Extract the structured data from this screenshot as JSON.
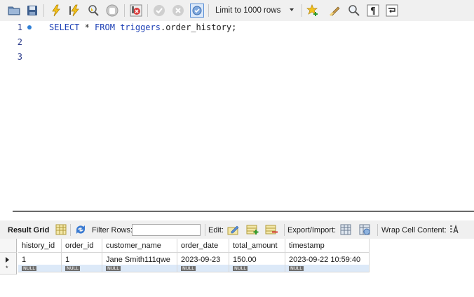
{
  "toolbar": {
    "buttons": [
      {
        "name": "open-folder-icon"
      },
      {
        "name": "save-icon"
      },
      {
        "name": "execute-lightning-icon"
      },
      {
        "name": "execute-cursor-lightning-icon"
      },
      {
        "name": "explain-magnifier-icon"
      },
      {
        "name": "stop-hand-icon"
      },
      {
        "name": "toggle-continue-on-error-icon"
      },
      {
        "name": "commit-check-icon"
      },
      {
        "name": "rollback-cancel-icon"
      },
      {
        "name": "autocommit-toggle-icon"
      },
      {
        "name": "add-snippet-star-icon"
      },
      {
        "name": "beautify-broom-icon"
      },
      {
        "name": "find-replace-magnifier-icon"
      },
      {
        "name": "invisible-chars-pilcrow-icon"
      },
      {
        "name": "wrap-lines-icon"
      }
    ],
    "limit_select": {
      "value": "Limit to 1000 rows"
    }
  },
  "editor": {
    "lines": [
      {
        "number": "1",
        "has_marker": true,
        "tokens": [
          {
            "text": "SELECT",
            "type": "kw"
          },
          {
            "text": " * ",
            "type": "plain"
          },
          {
            "text": "FROM",
            "type": "kw"
          },
          {
            "text": " ",
            "type": "plain"
          },
          {
            "text": "triggers",
            "type": "id"
          },
          {
            "text": ".order_history;",
            "type": "plain"
          }
        ]
      },
      {
        "number": "2",
        "has_marker": false,
        "tokens": []
      },
      {
        "number": "3",
        "has_marker": false,
        "tokens": []
      }
    ]
  },
  "result_toolbar": {
    "result_grid_label": "Result Grid",
    "filter_rows_label": "Filter Rows:",
    "filter_rows_value": "",
    "edit_label": "Edit:",
    "export_import_label": "Export/Import:",
    "wrap_cell_label": "Wrap Cell Content:"
  },
  "grid": {
    "columns": [
      "history_id",
      "order_id",
      "customer_name",
      "order_date",
      "total_amount",
      "timestamp"
    ],
    "rows": [
      [
        "1",
        "1",
        "Jane Smith111qwe",
        "2023-09-23",
        "150.00",
        "2023-09-22 10:59:40"
      ]
    ],
    "null_label": "NULL"
  },
  "colors": {
    "keyword": "#1c3fb5",
    "marker": "#2f7fd6",
    "null_row_bg": "#dce9f8",
    "toolbar_bg": "#f0f0f0"
  }
}
